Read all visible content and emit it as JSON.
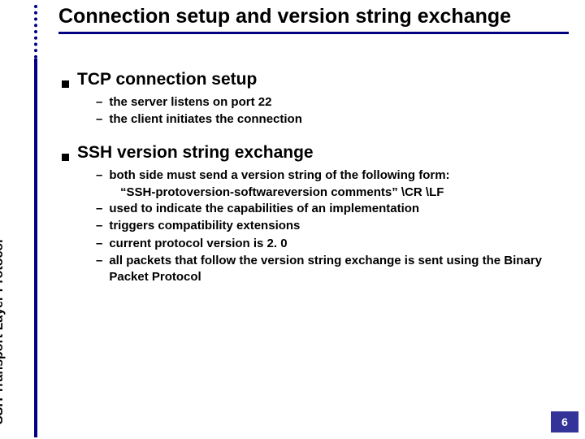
{
  "title": "Connection setup and version string exchange",
  "sidebar_label": "SSH Transport Layer Protocol",
  "sections": [
    {
      "heading": "TCP connection setup",
      "items": [
        {
          "text": "the server listens on port 22"
        },
        {
          "text": "the client initiates the connection"
        }
      ]
    },
    {
      "heading": "SSH version string exchange",
      "items": [
        {
          "text": "both side must send a version string of the following form:",
          "sub": "“SSH-protoversion-softwareversion comments” \\CR \\LF"
        },
        {
          "text": "used to indicate the capabilities of an implementation"
        },
        {
          "text": "triggers compatibility extensions"
        },
        {
          "text": "current protocol version is 2. 0"
        },
        {
          "text": "all packets that follow the version string exchange is sent using the Binary Packet Protocol"
        }
      ]
    }
  ],
  "page_number": "6"
}
